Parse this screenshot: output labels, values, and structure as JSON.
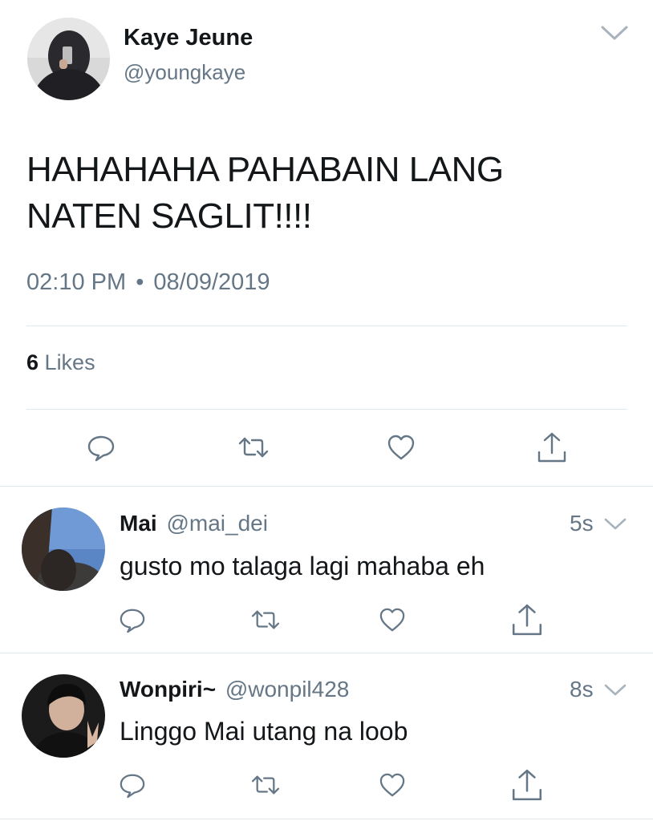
{
  "main_tweet": {
    "author_name": "Kaye Jeune",
    "author_handle": "@youngkaye",
    "text_line1": "HAHAHAHA PAHABAIN LANG",
    "text_line2": "NATEN SAGLIT!!!!",
    "time": "02:10 PM",
    "separator": "•",
    "date": "08/09/2019",
    "likes_count": "6",
    "likes_label": "Likes"
  },
  "replies": [
    {
      "author_name": "Mai",
      "author_handle": "@mai_dei",
      "age": "5s",
      "text": "gusto mo talaga lagi mahaba eh"
    },
    {
      "author_name": "Wonpiri~",
      "author_handle": "@wonpil428",
      "age": "8s",
      "text": "Linggo Mai utang na loob"
    }
  ],
  "icons": {
    "reply": "reply-icon",
    "retweet": "retweet-icon",
    "like": "like-icon",
    "share": "share-icon",
    "more": "chevron-down-icon"
  },
  "colors": {
    "text": "#14171a",
    "muted": "#657786",
    "divider": "#e1e8ed"
  }
}
